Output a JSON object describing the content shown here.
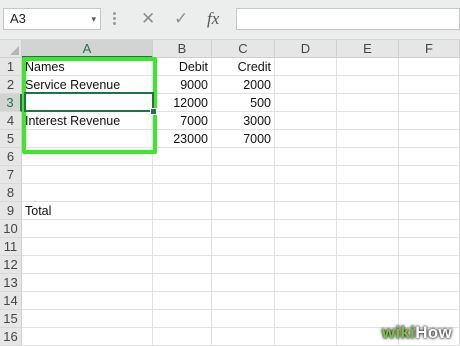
{
  "formula_bar": {
    "name_box": "A3",
    "name_box_dropdown": "▾",
    "cancel_icon": "✕",
    "enter_icon": "✓",
    "fx_label": "fx",
    "formula": ""
  },
  "columns": [
    "A",
    "B",
    "C",
    "D",
    "E",
    "F"
  ],
  "rows": [
    "1",
    "2",
    "3",
    "4",
    "5",
    "6",
    "7",
    "8",
    "9",
    "10",
    "11",
    "12",
    "13",
    "14",
    "15",
    "16"
  ],
  "cells": {
    "A1": "Names",
    "B1": "Debit",
    "C1": "Credit",
    "A2": "Service Revenue",
    "B2": "9000",
    "C2": "2000",
    "A3": "",
    "B3": "12000",
    "C3": "500",
    "A4": "Interest Revenue",
    "B4": "7000",
    "C4": "3000",
    "B5": "23000",
    "C5": "7000",
    "A9": "Total"
  },
  "selection": {
    "active_cell": "A3"
  },
  "colors": {
    "accent": "#217346",
    "highlight": "#3be82c"
  },
  "watermark": {
    "part1": "wiki",
    "part2": "How"
  }
}
